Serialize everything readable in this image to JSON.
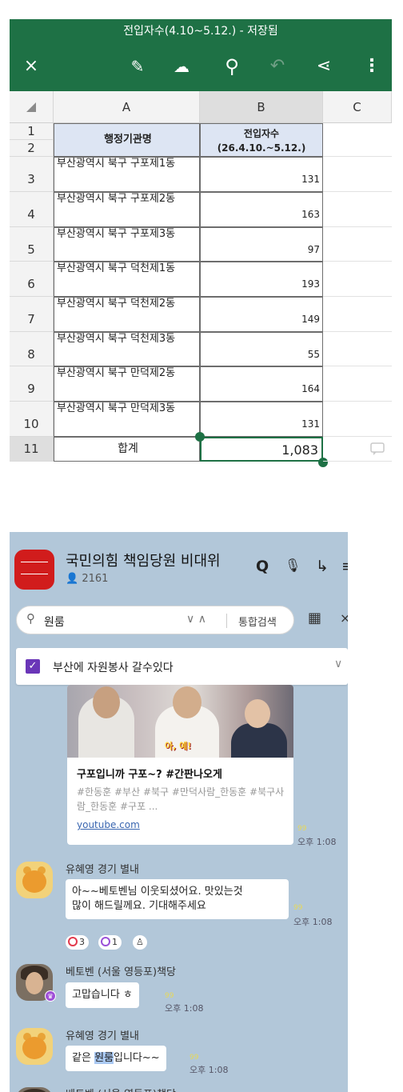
{
  "excel": {
    "title": "전입자수(4.10~5.12.) - 저장됨",
    "toolbar": {
      "close": "×",
      "edit": "✎",
      "upload": "☁",
      "search": "⚲",
      "undo": "↶",
      "share": "⋖",
      "more": "⋮"
    },
    "columns": [
      "A",
      "B",
      "C"
    ],
    "header_a": "행정기관명",
    "header_b_line1": "전입자수",
    "header_b_line2": "(26.4.10.~5.12.)",
    "row_numbers": [
      "1",
      "2",
      "3",
      "4",
      "5",
      "6",
      "7",
      "8",
      "9",
      "10",
      "11"
    ],
    "rows": [
      {
        "name": "부산광역시 북구 구포제1동",
        "value": "131"
      },
      {
        "name": "부산광역시 북구 구포제2동",
        "value": "163"
      },
      {
        "name": "부산광역시 북구 구포제3동",
        "value": "97"
      },
      {
        "name": "부산광역시 북구 덕천제1동",
        "value": "193"
      },
      {
        "name": "부산광역시 북구 덕천제2동",
        "value": "149"
      },
      {
        "name": "부산광역시 북구 덕천제3동",
        "value": "55"
      },
      {
        "name": "부산광역시 북구 만덕제2동",
        "value": "164"
      },
      {
        "name": "부산광역시 북구 만덕제3동",
        "value": "131"
      }
    ],
    "total_label": "합계",
    "total_value": "1,083",
    "colors": {
      "ribbon": "#1e7145",
      "selection": "#1e7145"
    }
  },
  "kakao": {
    "room_name": "국민의힘 책임당원 비대위",
    "member_count": "2161",
    "header_icons": {
      "search": "Q",
      "mic": "🎙",
      "share": "↳",
      "more": "≡"
    },
    "search": {
      "query": "원룸",
      "arrows": "∨ ∧",
      "integrated": "통합검색",
      "calendar": "▦",
      "close": "×"
    },
    "notice": {
      "text": "부산에 자원봉사 갈수있다",
      "check": "✓",
      "chevron": "∨"
    },
    "link_card": {
      "caption": "아, 예!",
      "title": "구포입니까 구포~? #간판나오게",
      "tags": "#한동훈 #부산 #북구 #만덕사람_한동훈 #북구사람_한동훈 #구포 ...",
      "url": "youtube.com",
      "read": "99",
      "time": "오후 1:08"
    },
    "messages": [
      {
        "sender": "유혜영 경기 별내",
        "lines": [
          "아~~베토벤님 이웃되셨어요. 맛있는것",
          "많이 해드릴께요. 기대해주세요"
        ],
        "read": "99",
        "time": "오후 1:08",
        "reactions": [
          {
            "count": "3"
          },
          {
            "count": "1"
          },
          {
            "count": ""
          }
        ]
      },
      {
        "sender": "베토벤 (서울 영등포)책당",
        "text": "고맙습니다 ㅎ",
        "read": "99",
        "time": "오후 1:08",
        "badge": "♛"
      },
      {
        "sender": "유혜영 경기 별내",
        "text_before": "같은 ",
        "text_highlight": "원룸",
        "text_after": "입니다~~",
        "read": "99",
        "time": "오후 1:08"
      },
      {
        "sender": "베토벤 (서울 영등포)책당"
      }
    ]
  }
}
